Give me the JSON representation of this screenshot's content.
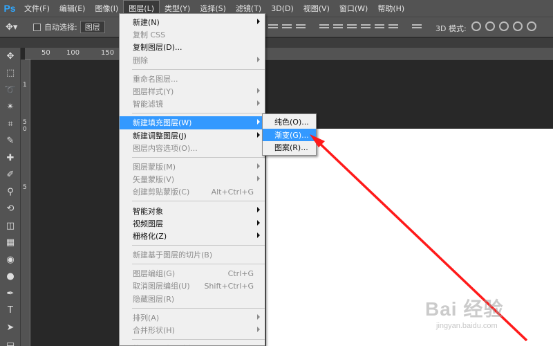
{
  "app": {
    "logo": "Ps"
  },
  "menubar": [
    {
      "label": "文件(F)"
    },
    {
      "label": "编辑(E)"
    },
    {
      "label": "图像(I)"
    },
    {
      "label": "图层(L)",
      "active": true
    },
    {
      "label": "类型(Y)"
    },
    {
      "label": "选择(S)"
    },
    {
      "label": "滤镜(T)"
    },
    {
      "label": "3D(D)"
    },
    {
      "label": "视图(V)"
    },
    {
      "label": "窗口(W)"
    },
    {
      "label": "帮助(H)"
    }
  ],
  "options_bar": {
    "auto_select_label": "自动选择:",
    "auto_select_value": "图层",
    "mode_3d_label": "3D 模式:"
  },
  "ruler": {
    "top": [
      "50",
      "100",
      "150"
    ],
    "left": [
      "1",
      "5",
      "0",
      "5"
    ]
  },
  "layer_menu": [
    {
      "label": "新建(N)",
      "submenu": true
    },
    {
      "label": "复制 CSS",
      "disabled": true
    },
    {
      "label": "复制图层(D)..."
    },
    {
      "label": "删除",
      "disabled": true,
      "submenu": true
    },
    {
      "sep": true
    },
    {
      "label": "重命名图层...",
      "disabled": true
    },
    {
      "label": "图层样式(Y)",
      "disabled": true,
      "submenu": true
    },
    {
      "label": "智能滤镜",
      "disabled": true,
      "submenu": true
    },
    {
      "sep": true
    },
    {
      "label": "新建填充图层(W)",
      "submenu": true,
      "highlight": true
    },
    {
      "label": "新建调整图层(J)",
      "submenu": true
    },
    {
      "label": "图层内容选项(O)...",
      "disabled": true
    },
    {
      "sep": true
    },
    {
      "label": "图层蒙版(M)",
      "disabled": true,
      "submenu": true
    },
    {
      "label": "矢量蒙版(V)",
      "disabled": true,
      "submenu": true
    },
    {
      "label": "创建剪贴蒙版(C)",
      "disabled": true,
      "shortcut": "Alt+Ctrl+G"
    },
    {
      "sep": true
    },
    {
      "label": "智能对象",
      "submenu": true
    },
    {
      "label": "视频图层",
      "submenu": true
    },
    {
      "label": "栅格化(Z)",
      "submenu": true
    },
    {
      "sep": true
    },
    {
      "label": "新建基于图层的切片(B)",
      "disabled": true
    },
    {
      "sep": true
    },
    {
      "label": "图层编组(G)",
      "disabled": true,
      "shortcut": "Ctrl+G"
    },
    {
      "label": "取消图层编组(U)",
      "disabled": true,
      "shortcut": "Shift+Ctrl+G"
    },
    {
      "label": "隐藏图层(R)",
      "disabled": true
    },
    {
      "sep": true
    },
    {
      "label": "排列(A)",
      "disabled": true,
      "submenu": true
    },
    {
      "label": "合并形状(H)",
      "disabled": true,
      "submenu": true
    },
    {
      "sep": true
    },
    {
      "label": "将图层与选区对齐(I)",
      "disabled": true,
      "submenu": true
    }
  ],
  "fill_submenu": [
    {
      "label": "纯色(O)..."
    },
    {
      "label": "渐变(G)...",
      "highlight": true
    },
    {
      "label": "图案(R)..."
    }
  ],
  "tools": [
    "move-tool",
    "marquee-tool",
    "lasso-tool",
    "magic-wand-tool",
    "crop-tool",
    "eyedropper-tool",
    "healing-brush-tool",
    "brush-tool",
    "clone-stamp-tool",
    "history-brush-tool",
    "eraser-tool",
    "gradient-tool",
    "blur-tool",
    "dodge-tool",
    "pen-tool",
    "type-tool",
    "path-selection-tool",
    "rectangle-tool"
  ],
  "annotation": {
    "color": "#ff1a1a"
  },
  "watermark": {
    "logo": "Bai 经验",
    "url": "jingyan.baidu.com"
  }
}
